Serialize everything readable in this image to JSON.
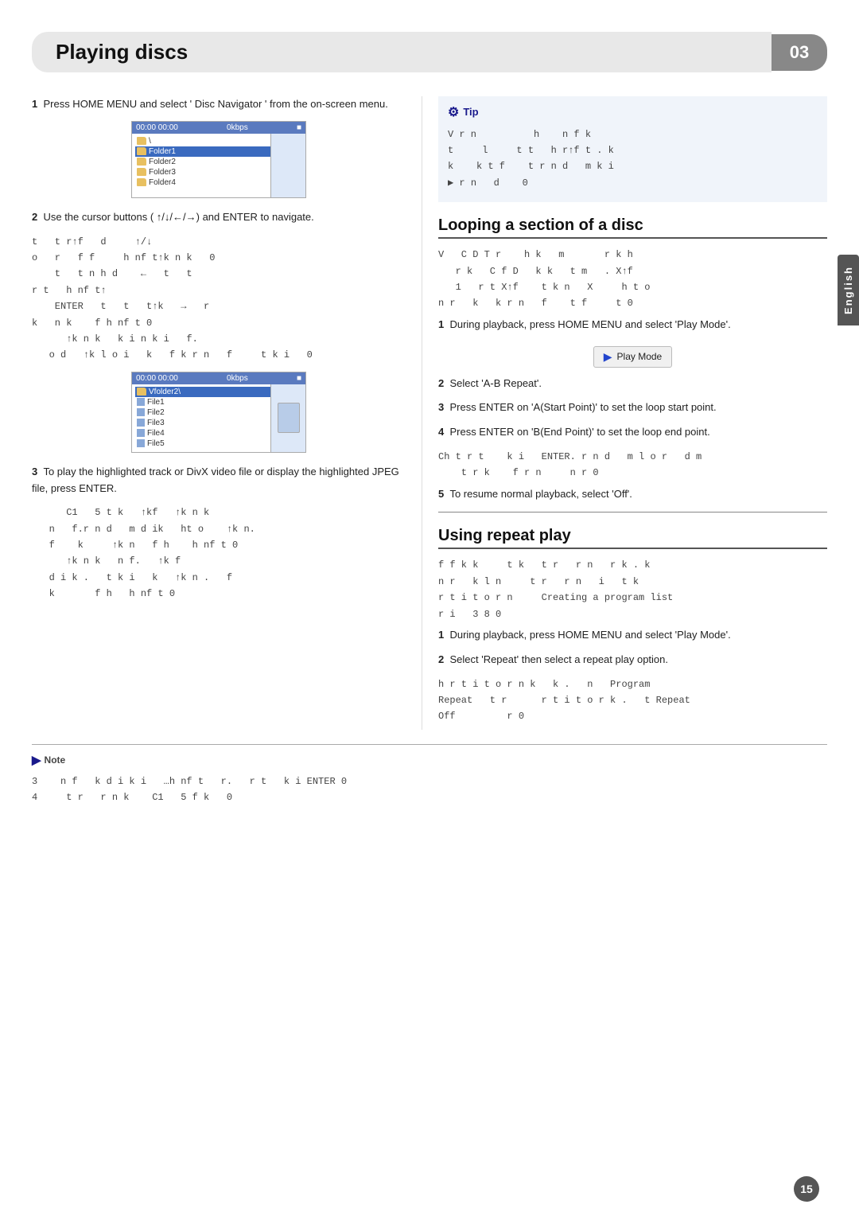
{
  "chapter": {
    "title": "Playing discs",
    "number": "03"
  },
  "english_tab": "English",
  "page_number": "15",
  "left_col": {
    "step1_text": "Press HOME MENU and select ' Disc Navigator ' from the on-screen menu.",
    "screen1": {
      "header_time": "00:00  00:00",
      "header_info": "0kbps",
      "header_icon": "■",
      "root_label": "\\",
      "folders": [
        "Folder1",
        "Folder2",
        "Folder3",
        "Folder4"
      ]
    },
    "step2_text": "Use the cursor buttons (  ↑/↓/←/→) and ENTER to navigate.",
    "scrambled_lines": [
      "t  t r↑f  d    ↑/↓",
      "o  r  f f     h nf t↑k n k  0",
      "t  t n h d    ←  t  t",
      "r t  h nf t↑",
      "ENTER  t  t  t↑k  →  r",
      "k  n k   f h nf t 0",
      "↑k n k  k i n k i  f.",
      "o d  ↑k l o i  k  f k r n  f    t k i  0"
    ],
    "screen2": {
      "header_time": "00:00  00:00",
      "header_info": "0kbps",
      "root_label": "Vfolder2\\",
      "files": [
        "File1",
        "File2",
        "File3",
        "File4",
        "File5"
      ]
    },
    "step3_text": "To play the highlighted track  or DivX video file or display the highlighted JPEG file, press ENTER.",
    "scrambled_step3": [
      "C1  5 t k  ↑kf  ↑k n k",
      "n  f.r n d  m d ik  ht o   ↑k n.",
      "f   k    ↑k n  f h   h nf t 0",
      "↑k n k  n f.  ↑k f",
      "d i k .  t k i  k  ↑k n .  f",
      "k     f h  h nf t 0"
    ]
  },
  "right_col": {
    "tip": {
      "title": "Tip",
      "lines": [
        "V r n        h   n f k",
        "t    l    t t  h r↑f t . k",
        "k   k t f   t r n d  m k i",
        "▶ r n  d   0"
      ]
    },
    "looping_section": {
      "heading": "Looping a section of a disc",
      "intro_scrambled": [
        "V  C D T r   h k  m     r k h",
        "  r k  C f D  k k  t m  . X↑f",
        "1  r t X↑f   t k n  X    h t o",
        "n r  k  k r n  f   t f    t 0"
      ],
      "step1": "During playback, press HOME MENU and select 'Play Mode'.",
      "play_mode_btn": "Play Mode",
      "step2": "Select 'A-B Repeat'.",
      "step3": "Press ENTER on 'A(Start Point)' to set the loop start point.",
      "step4": "Press ENTER on 'B(End Point)' to set the loop end point.",
      "scrambled_step4": [
        "Ch t r t   k i  ENTER. r n d  m l o r  d m",
        "   t r k   f r n    n r 0"
      ],
      "step5": "To resume normal playback, select 'Off'."
    },
    "repeat_section": {
      "heading": "Using repeat play",
      "intro_scrambled": [
        "f f k k    t k  t r  r n  r k . k",
        "n r  k l n    t r  r n  i  t k",
        "r t i t o r n    Creating a program list",
        "r i  3 8 0"
      ],
      "step1": "During playback, press HOME MENU and select 'Play Mode'.",
      "step2": "Select 'Repeat' then select a repeat play option.",
      "scrambled_step2": [
        "h r t i t o r n k  k .  n  Program",
        "Repeat  t r     r t i t o r k .  t Repeat",
        "Off       r 0"
      ]
    }
  },
  "note": {
    "title": "Note",
    "lines": [
      "3   n f  k d i k i  …h nf t  r.  r t  k i ENTER 0",
      "4    t r  r n k   C1  5 f k  0"
    ]
  }
}
